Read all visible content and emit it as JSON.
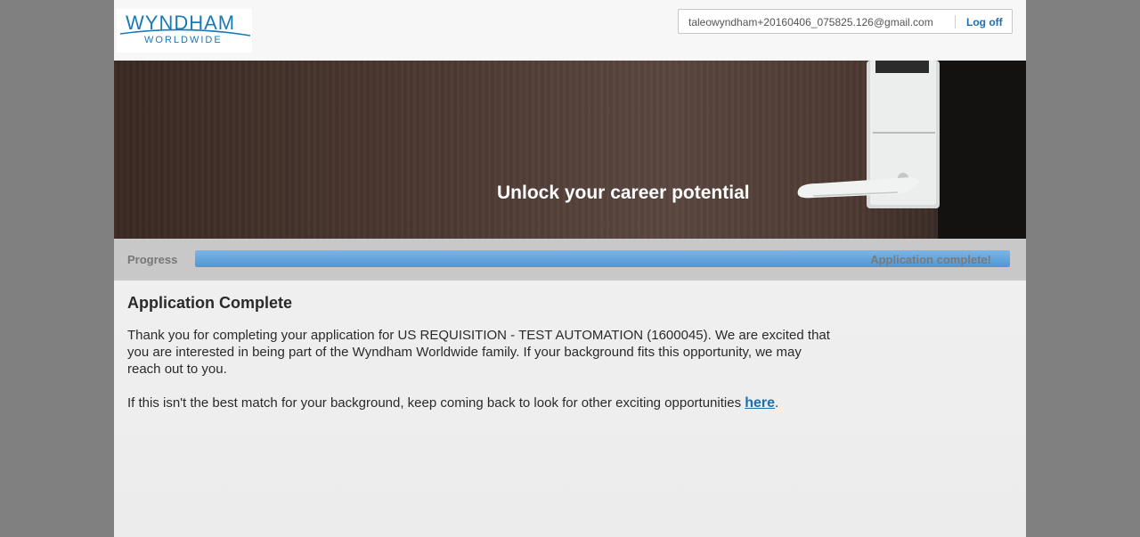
{
  "header": {
    "logo": {
      "main": "WYNDHAM",
      "sub": "WORLDWIDE",
      "icon": "wyndham-swoosh-logo"
    },
    "user_email": "taleowyndham+20160406_075825.126@gmail.com",
    "logoff_label": "Log off"
  },
  "banner": {
    "tagline": "Unlock your career potential"
  },
  "progress": {
    "label": "Progress",
    "status": "Application complete!",
    "fraction": 1.0
  },
  "main": {
    "title": "Application Complete",
    "paragraph1": "Thank you for completing your application for US REQUISITION - TEST AUTOMATION (1600045). We are excited that you are interested in being part of the Wyndham Worldwide family. If your background fits this opportunity, we may reach out to you.",
    "paragraph2_before": "If this isn't the best match for your background, keep coming back to look for other exciting opportunities ",
    "paragraph2_link": "here",
    "paragraph2_after": "."
  },
  "colors": {
    "brand_blue": "#1a7ab8",
    "link_blue": "#1a6fb0",
    "progress_fill": "#4f97d4",
    "backdrop": "#808080"
  }
}
